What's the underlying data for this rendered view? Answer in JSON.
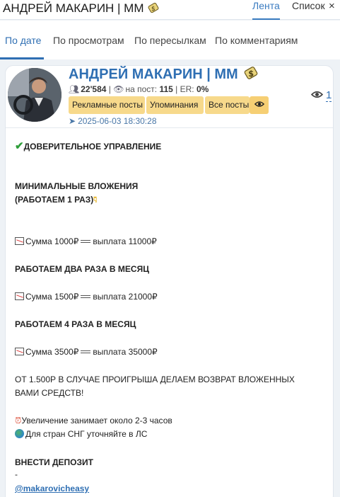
{
  "window": {
    "title": "АНДРЕЙ МАКАРИН | ММ",
    "view_tabs": [
      "Лента",
      "Список"
    ],
    "close_symbol": "×"
  },
  "sort_tabs": [
    "По дате",
    "По просмотрам",
    "По пересылкам",
    "По комментариям"
  ],
  "channel": {
    "name": "АНДРЕЙ МАКАРИН | ММ",
    "subscribers": "22'584",
    "per_post_label": "на пост:",
    "per_post": "115",
    "er_label": "ER:",
    "er": "0%",
    "buttons": [
      "Рекламные посты",
      "Упоминания",
      "Все посты"
    ],
    "datetime": "2025-06-03 18:30:28",
    "views_count": "1"
  },
  "post": {
    "heading": "ДОВЕРИТЕЛЬНОЕ УПРАВЛЕНИЕ",
    "min_invest_1": "МИНИМАЛЬНЫЕ ВЛОЖЕНИЯ",
    "min_invest_2": "(РАБОТАЕМ 1 РАЗ)",
    "sum1_a": "Сумма 1000₽",
    "sum1_b": "выплата 11000₽",
    "twice": "РАБОТАЕМ ДВА РАЗА В МЕСЯЦ",
    "sum2_a": "Сумма 1500₽",
    "sum2_b": "выплата 21000₽",
    "four": "РАБОТАЕМ 4 РАЗА В МЕСЯЦ",
    "sum3_a": "Сумма 3500₽",
    "sum3_b": "выплата 35000₽",
    "refund_1": "ОТ 1.500Р В СЛУЧАЕ ПРОИГРЫША ДЕЛАЕМ ВОЗВРАТ ВЛОЖЕННЫХ",
    "refund_2": "ВАМИ СРЕДСТВ!",
    "duration": "Увеличение занимает около 2-3 часов",
    "cis": "Для стран СНГ уточняйте в ЛС",
    "deposit": "ВНЕСТИ ДЕПОЗИТ",
    "dash": "-",
    "contact": "@makarovicheasy"
  },
  "icons": {
    "check": "check-icon",
    "point_down": "point-down-icon",
    "chart": "chart-icon",
    "equals": "equals-icon",
    "clock": "alarm-clock-icon",
    "globe": "globe-icon",
    "eye": "eye-icon",
    "plane": "paper-plane-icon",
    "people": "people-icon",
    "badge": "money-bag-icon"
  },
  "colors": {
    "accent": "#2f6fb3",
    "chip": "#f7d98b",
    "background": "#eef2f6"
  }
}
